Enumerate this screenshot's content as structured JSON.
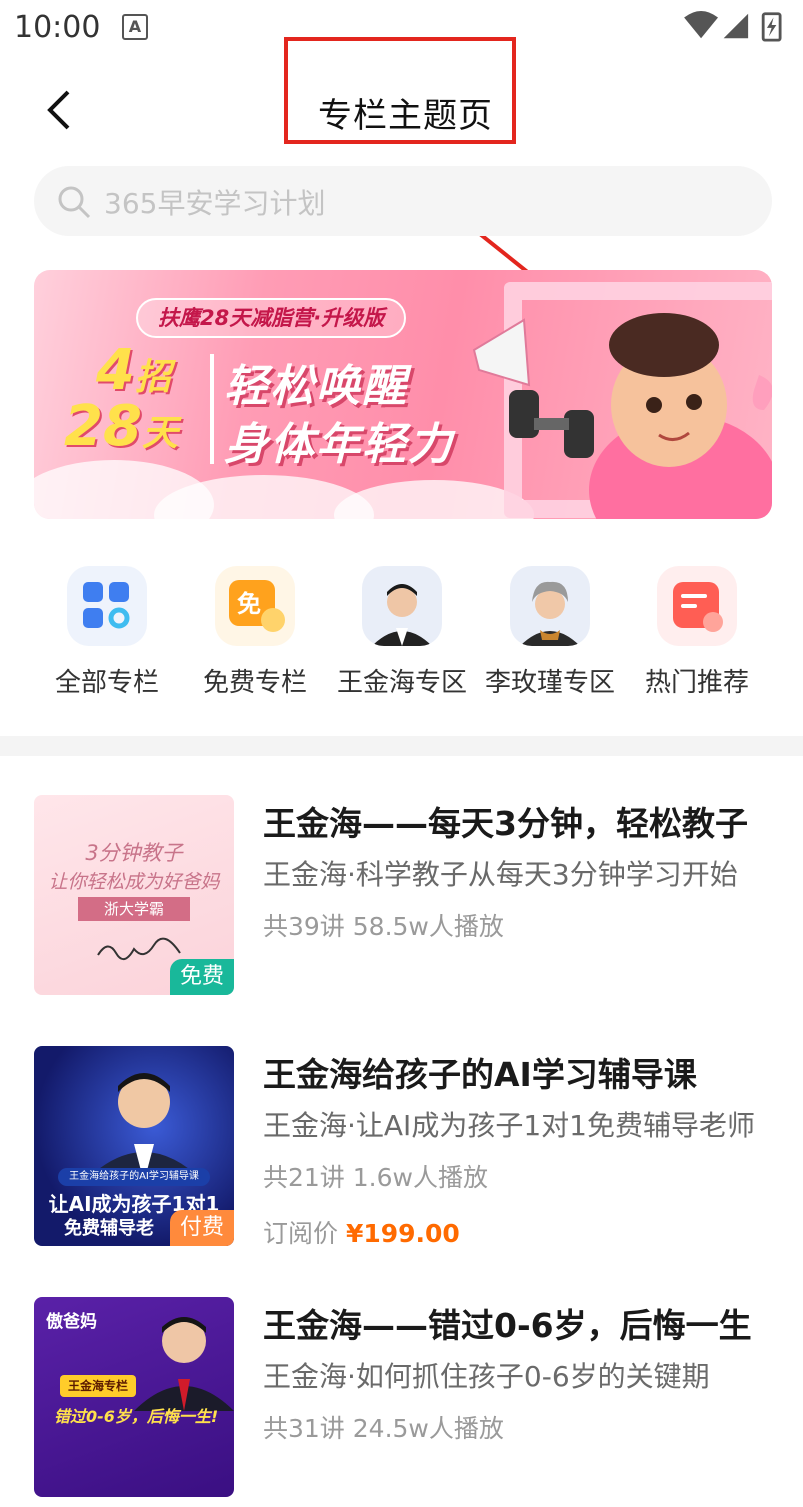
{
  "status_bar": {
    "time": "10:00",
    "notification_glyph": "A"
  },
  "header": {
    "title": "专栏主题页"
  },
  "search": {
    "placeholder": "365早安学习计划"
  },
  "banner": {
    "pill": "扶鹰28天减脂营·升级版",
    "num1": "4",
    "unit1": "招",
    "num2": "28",
    "unit2": "天",
    "line1": "轻松唤醒",
    "line2": "身体年轻力"
  },
  "categories": [
    {
      "label": "全部专栏",
      "icon": "grid-icon"
    },
    {
      "label": "免费专栏",
      "icon": "free-icon"
    },
    {
      "label": "王金海专区",
      "icon": "avatar-icon"
    },
    {
      "label": "李玫瑾专区",
      "icon": "avatar-icon"
    },
    {
      "label": "热门推荐",
      "icon": "hot-icon"
    }
  ],
  "items": [
    {
      "title": "王金海——每天3分钟，轻松教子",
      "subtitle": "王金海·科学教子从每天3分钟学习开始",
      "stats": "共39讲  58.5w人播放",
      "badge": "免费",
      "thumb_line1": "3分钟教子",
      "thumb_line2": "让你轻松成为好爸妈",
      "thumb_tag": "浙大学霸"
    },
    {
      "title": "王金海给孩子的AI学习辅导课",
      "subtitle": "王金海·让AI成为孩子1对1免费辅导老师",
      "stats": "共21讲  1.6w人播放",
      "price_label": "订阅价 ",
      "price": "¥199.00",
      "badge": "付费",
      "thumb_small": "王金海给孩子的AI学习辅导课",
      "thumb_line1": "让AI成为孩子1对1",
      "thumb_line2": "免费辅导老"
    },
    {
      "title": "王金海——错过0-6岁，后悔一生",
      "subtitle": "王金海·如何抓住孩子0-6岁的关键期",
      "stats": "共31讲  24.5w人播放",
      "thumb_brand": "傲爸妈",
      "thumb_tag": "王金海专栏",
      "thumb_line1": "错过0-6岁，后悔一生!"
    }
  ],
  "colors": {
    "annotation": "#e3261e",
    "price": "#ff6a00",
    "free_badge": "#19b89a",
    "paid_badge": "#ff8a3c"
  }
}
